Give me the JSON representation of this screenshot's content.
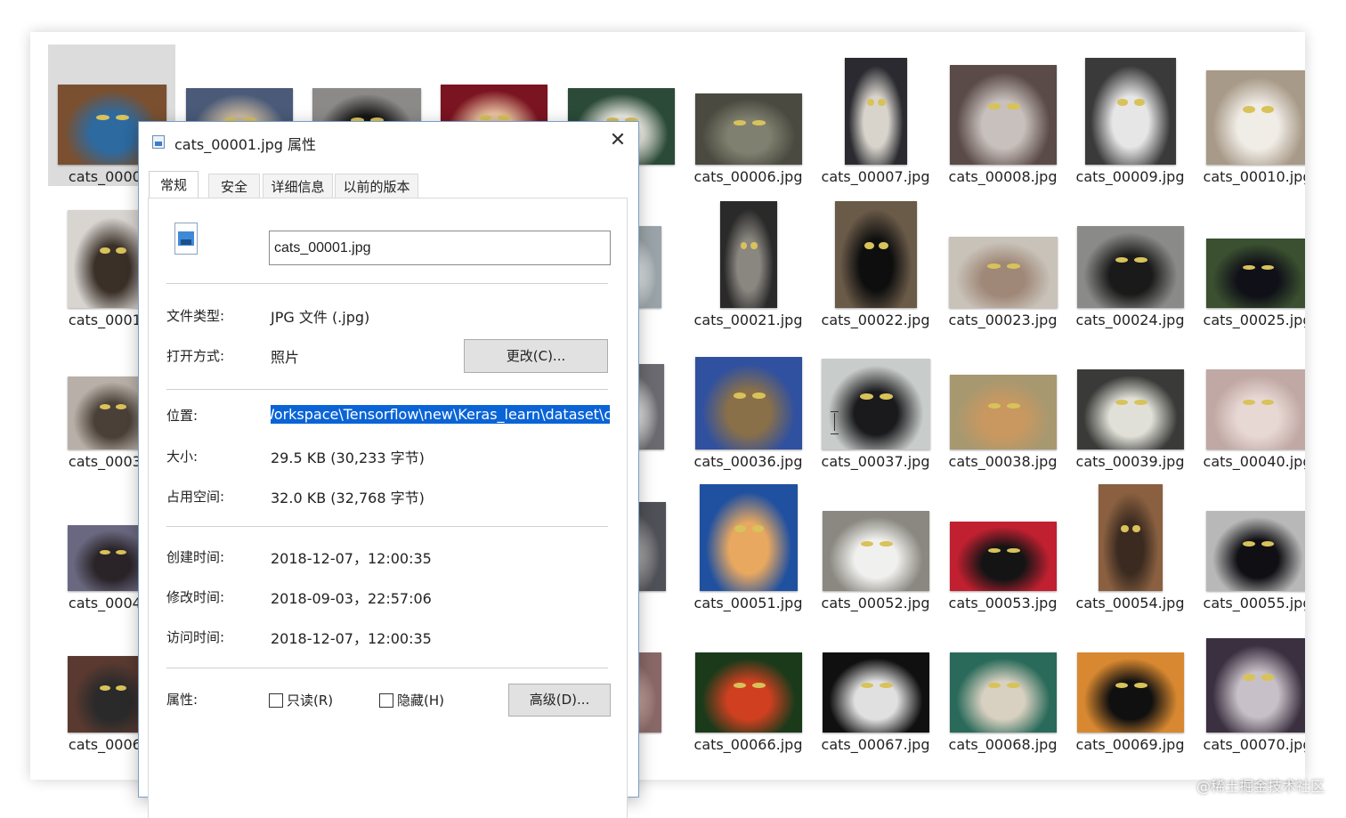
{
  "explorer": {
    "tiles": [
      {
        "label": "cats_00001.",
        "selected": true,
        "colors": [
          "#7a5030",
          "#2d6aa0"
        ]
      },
      {
        "label": "",
        "colors": [
          "#4a5a78",
          "#c9b8a0"
        ]
      },
      {
        "label": "",
        "colors": [
          "#8c8a88",
          "#151515"
        ]
      },
      {
        "label": "",
        "colors": [
          "#7a1420",
          "#e8c0a0"
        ]
      },
      {
        "label": "5.jpg",
        "colors": [
          "#2b4a38",
          "#e8e8e0"
        ]
      },
      {
        "label": "cats_00006.jpg",
        "colors": [
          "#4a4a40",
          "#808070"
        ]
      },
      {
        "label": "cats_00007.jpg",
        "colors": [
          "#2a2a30",
          "#d8d4cc"
        ]
      },
      {
        "label": "cats_00008.jpg",
        "colors": [
          "#5a4a48",
          "#c8c0bc"
        ]
      },
      {
        "label": "cats_00009.jpg",
        "colors": [
          "#3a3a3a",
          "#e6e6e6"
        ]
      },
      {
        "label": "cats_00010.jpg",
        "colors": [
          "#a89a88",
          "#f0ece6"
        ]
      },
      {
        "label": "cats_00016.",
        "colors": [
          "#d8d4d0",
          "#3a3028"
        ]
      },
      {
        "label": "",
        "colors": [
          "#fff",
          "#fff"
        ]
      },
      {
        "label": "",
        "colors": [
          "#fff",
          "#fff"
        ]
      },
      {
        "label": "",
        "colors": [
          "#fff",
          "#fff"
        ]
      },
      {
        "label": ").jpg",
        "colors": [
          "#9aa4a8",
          "#e8ecee"
        ]
      },
      {
        "label": "cats_00021.jpg",
        "colors": [
          "#2a2a2a",
          "#8a8680"
        ]
      },
      {
        "label": "cats_00022.jpg",
        "colors": [
          "#6a5a48",
          "#0e0e0e"
        ]
      },
      {
        "label": "cats_00023.jpg",
        "colors": [
          "#c8c2b8",
          "#a08878"
        ]
      },
      {
        "label": "cats_00024.jpg",
        "colors": [
          "#8a8a88",
          "#1a1a1a"
        ]
      },
      {
        "label": "cats_00025.jpg",
        "colors": [
          "#3a5030",
          "#101018"
        ]
      },
      {
        "label": "cats_00031.",
        "colors": [
          "#b8b0a8",
          "#4a4038"
        ]
      },
      {
        "label": "",
        "colors": [
          "#fff",
          "#fff"
        ]
      },
      {
        "label": "",
        "colors": [
          "#fff",
          "#fff"
        ]
      },
      {
        "label": "",
        "colors": [
          "#fff",
          "#fff"
        ]
      },
      {
        "label": "5.jpg",
        "colors": [
          "#6a6a70",
          "#e8e8e8"
        ]
      },
      {
        "label": "cats_00036.jpg",
        "colors": [
          "#3050a0",
          "#8a7048"
        ]
      },
      {
        "label": "cats_00037.jpg",
        "colors": [
          "#c8ccca",
          "#1a1a1c"
        ]
      },
      {
        "label": "cats_00038.jpg",
        "colors": [
          "#a89870",
          "#c89860"
        ]
      },
      {
        "label": "cats_00039.jpg",
        "colors": [
          "#3a3a38",
          "#e0e0d8"
        ]
      },
      {
        "label": "cats_00040.jpg",
        "colors": [
          "#c0a8a4",
          "#e8d8d4"
        ]
      },
      {
        "label": "cats_00046.",
        "colors": [
          "#6a6880",
          "#2a2428"
        ]
      },
      {
        "label": "",
        "colors": [
          "#fff",
          "#fff"
        ]
      },
      {
        "label": "",
        "colors": [
          "#fff",
          "#fff"
        ]
      },
      {
        "label": "",
        "colors": [
          "#fff",
          "#fff"
        ]
      },
      {
        "label": ").jpg",
        "colors": [
          "#505058",
          "#a8a8a8"
        ]
      },
      {
        "label": "cats_00051.jpg",
        "colors": [
          "#2050a0",
          "#e8a860"
        ]
      },
      {
        "label": "cats_00052.jpg",
        "colors": [
          "#8a8880",
          "#f0f0ee"
        ]
      },
      {
        "label": "cats_00053.jpg",
        "colors": [
          "#c02030",
          "#141414"
        ]
      },
      {
        "label": "cats_00054.jpg",
        "colors": [
          "#8a6040",
          "#3a2a20"
        ]
      },
      {
        "label": "cats_00055.jpg",
        "colors": [
          "#b8b8b8",
          "#101014"
        ]
      },
      {
        "label": "cats_00061.",
        "colors": [
          "#5a3a30",
          "#2a2a2a"
        ]
      },
      {
        "label": "",
        "colors": [
          "#fff",
          "#fff"
        ]
      },
      {
        "label": "",
        "colors": [
          "#fff",
          "#fff"
        ]
      },
      {
        "label": "",
        "colors": [
          "#fff",
          "#fff"
        ]
      },
      {
        "label": "5.jpg",
        "colors": [
          "#8a6868",
          "#c8a8a0"
        ]
      },
      {
        "label": "cats_00066.jpg",
        "colors": [
          "#1a3a1a",
          "#d04020"
        ]
      },
      {
        "label": "cats_00067.jpg",
        "colors": [
          "#101010",
          "#e0e0e0"
        ]
      },
      {
        "label": "cats_00068.jpg",
        "colors": [
          "#2a6a5a",
          "#d8d0c0"
        ]
      },
      {
        "label": "cats_00069.jpg",
        "colors": [
          "#d88830",
          "#101010"
        ]
      },
      {
        "label": "cats_00070.jpg",
        "colors": [
          "#3a3040",
          "#c8c0c8"
        ]
      }
    ]
  },
  "dialog": {
    "title": "cats_00001.jpg 属性",
    "close_glyph": "✕",
    "tabs": [
      "常规",
      "安全",
      "详细信息",
      "以前的版本"
    ],
    "filename": "cats_00001.jpg",
    "file_type_label": "文件类型:",
    "file_type_value": "JPG 文件 (.jpg)",
    "open_with_label": "打开方式:",
    "open_with_value": "照片",
    "change_button": "更改(C)...",
    "location_label": "位置:",
    "location_value": "E:\\Workspace\\Tensorflow\\new\\Keras_learn\\dataset\\cats",
    "size_label": "大小:",
    "size_value": "29.5 KB (30,233 字节)",
    "disk_size_label": "占用空间:",
    "disk_size_value": "32.0 KB (32,768 字节)",
    "created_label": "创建时间:",
    "created_value": "2018-12-07，12:00:35",
    "modified_label": "修改时间:",
    "modified_value": "2018-09-03，22:57:06",
    "accessed_label": "访问时间:",
    "accessed_value": "2018-12-07，12:00:35",
    "attributes_label": "属性:",
    "readonly_label": "只读(R)",
    "hidden_label": "隐藏(H)",
    "advanced_button": "高级(D)..."
  },
  "watermark": "@稀土掘金技术社区"
}
